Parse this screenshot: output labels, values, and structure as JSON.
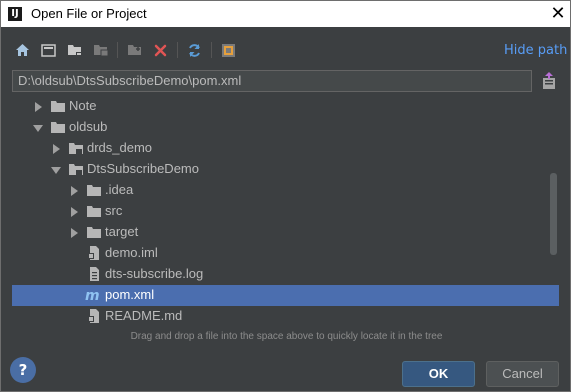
{
  "window": {
    "title": "Open File or Project",
    "app_icon_letter": "IJ"
  },
  "toolbar": {
    "icons": [
      "home-icon",
      "desktop-icon",
      "folder-icon",
      "module-folder-icon",
      "new-folder-icon",
      "delete-icon",
      "refresh-icon",
      "show-hidden-icon"
    ],
    "hide_path_label": "Hide path"
  },
  "path": {
    "value": "D:\\oldsub\\DtsSubscribeDemo\\pom.xml"
  },
  "tree": {
    "rows": [
      {
        "label": "Note",
        "expanded": false,
        "type": "folder"
      },
      {
        "label": "oldsub",
        "expanded": true,
        "type": "folder"
      },
      {
        "label": "drds_demo",
        "expanded": false,
        "type": "module-folder"
      },
      {
        "label": "DtsSubscribeDemo",
        "expanded": true,
        "type": "module-folder"
      },
      {
        "label": ".idea",
        "expanded": false,
        "type": "folder"
      },
      {
        "label": "src",
        "expanded": false,
        "type": "folder"
      },
      {
        "label": "target",
        "expanded": false,
        "type": "folder"
      },
      {
        "label": "demo.iml",
        "type": "file"
      },
      {
        "label": "dts-subscribe.log",
        "type": "file"
      },
      {
        "label": "pom.xml",
        "type": "maven",
        "selected": true
      },
      {
        "label": "README.md",
        "type": "file"
      }
    ]
  },
  "hint": "Drag and drop a file into the space above to quickly locate it in the tree",
  "buttons": {
    "help": "?",
    "ok": "OK",
    "cancel": "Cancel"
  },
  "colors": {
    "background": "#3c3f41",
    "selection": "#4b6eaf",
    "link": "#589df6",
    "ok_button": "#365880"
  }
}
